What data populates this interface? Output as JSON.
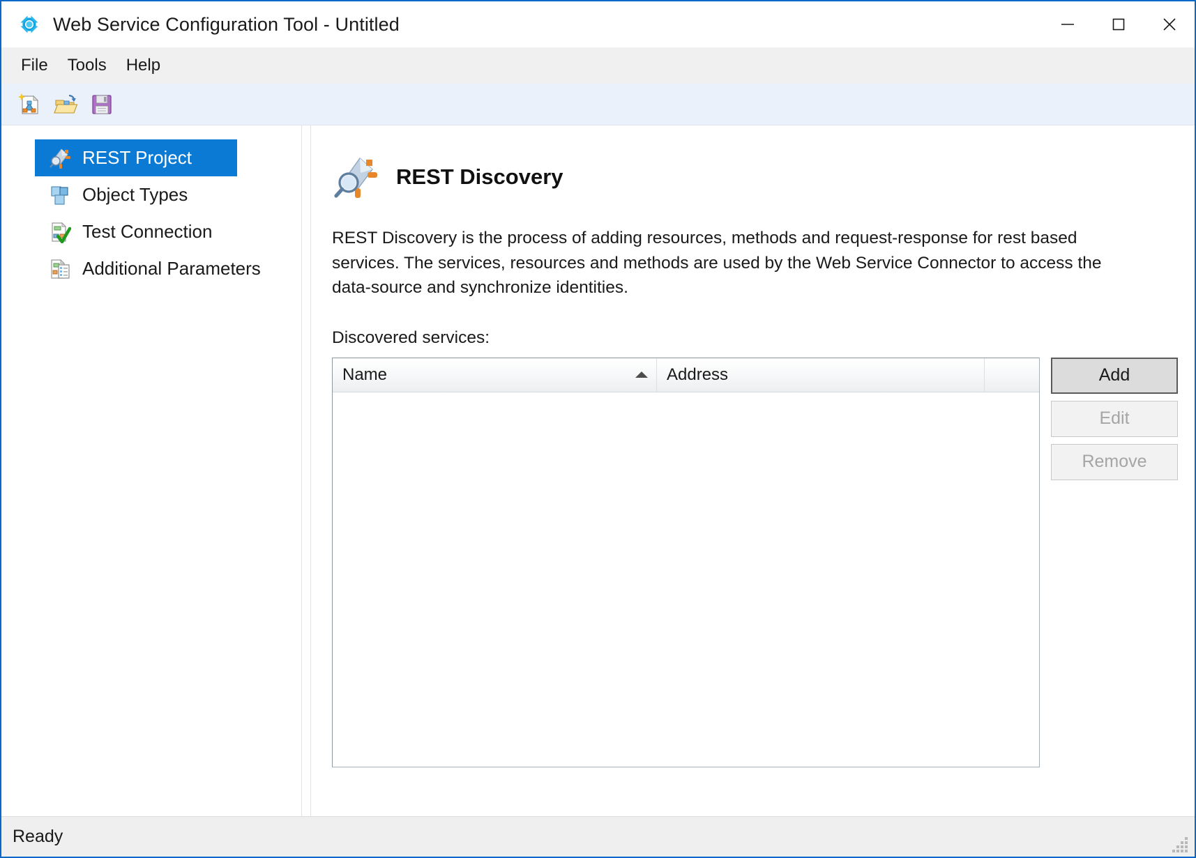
{
  "window": {
    "title": "Web Service Configuration Tool - Untitled",
    "app_icon": "diamond-network-icon",
    "controls": {
      "minimize": "minimize-icon",
      "maximize": "maximize-icon",
      "close": "close-icon"
    }
  },
  "menubar": {
    "items": [
      {
        "label": "File"
      },
      {
        "label": "Tools"
      },
      {
        "label": "Help"
      }
    ]
  },
  "toolbar": {
    "buttons": [
      {
        "name": "new-project-icon",
        "title": "New"
      },
      {
        "name": "open-folder-icon",
        "title": "Open"
      },
      {
        "name": "save-floppy-icon",
        "title": "Save"
      }
    ]
  },
  "sidebar": {
    "items": [
      {
        "label": "REST Project",
        "icon": "rest-project-icon",
        "selected": true
      },
      {
        "label": "Object Types",
        "icon": "object-types-icon",
        "selected": false
      },
      {
        "label": "Test Connection",
        "icon": "test-connection-icon",
        "selected": false
      },
      {
        "label": "Additional Parameters",
        "icon": "additional-parameters-icon",
        "selected": false
      }
    ]
  },
  "panel": {
    "icon": "rest-discovery-magnifier-icon",
    "title": "REST Discovery",
    "description": "REST Discovery is the process of adding resources, methods and request-response for rest based services. The services, resources and methods are used by the Web Service Connector to access the data-source and synchronize identities.",
    "list_label": "Discovered services:",
    "table": {
      "columns": [
        {
          "label": "Name",
          "sorted": "asc"
        },
        {
          "label": "Address",
          "sorted": ""
        },
        {
          "label": "",
          "sorted": ""
        }
      ],
      "rows": []
    },
    "buttons": [
      {
        "label": "Add",
        "state": "default"
      },
      {
        "label": "Edit",
        "state": "disabled"
      },
      {
        "label": "Remove",
        "state": "disabled"
      }
    ]
  },
  "statusbar": {
    "text": "Ready",
    "grip": "resize-grip-icon"
  },
  "colors": {
    "accent_border": "#0a69c8",
    "selection": "#0a7ad4",
    "toolbar_bg": "#eaf1fa",
    "menubar_bg": "#f0f0f0",
    "statusbar_bg": "#efefef"
  }
}
